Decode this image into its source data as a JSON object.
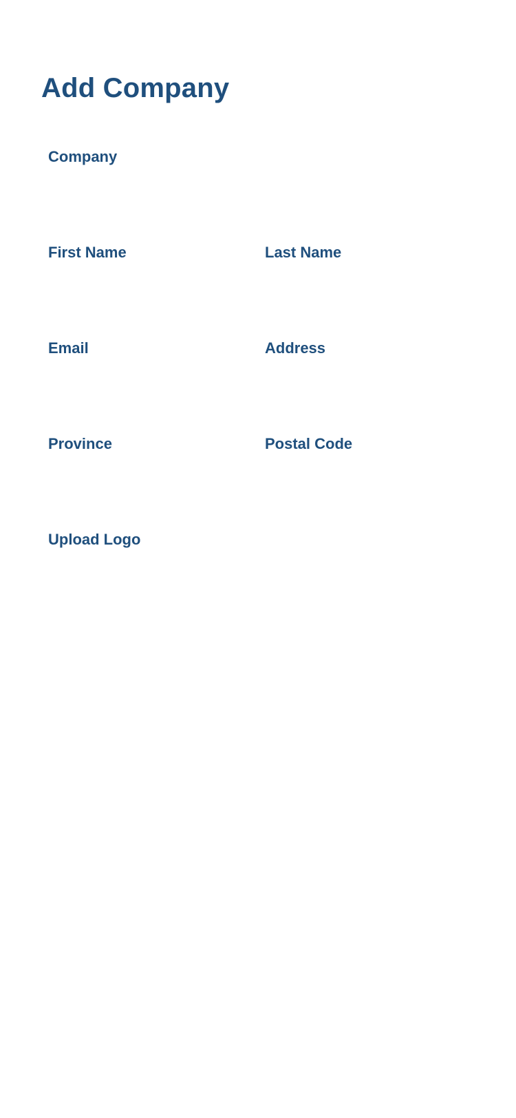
{
  "page": {
    "title": "Add Company"
  },
  "form": {
    "company": {
      "label": "Company",
      "value": "",
      "placeholder": ""
    },
    "first_name": {
      "label": "First Name",
      "value": "",
      "placeholder": ""
    },
    "last_name": {
      "label": "Last Name",
      "value": "",
      "placeholder": ""
    },
    "email": {
      "label": "Email",
      "value": "",
      "placeholder": ""
    },
    "address": {
      "label": "Address",
      "value": "",
      "placeholder": ""
    },
    "province": {
      "label": "Province",
      "value": "",
      "placeholder": ""
    },
    "postal_code": {
      "label": "Postal Code",
      "value": "",
      "placeholder": ""
    },
    "upload_logo": {
      "label": "Upload Logo"
    }
  },
  "theme": {
    "label_color": "#1f4f7d",
    "background": "#ffffff"
  }
}
